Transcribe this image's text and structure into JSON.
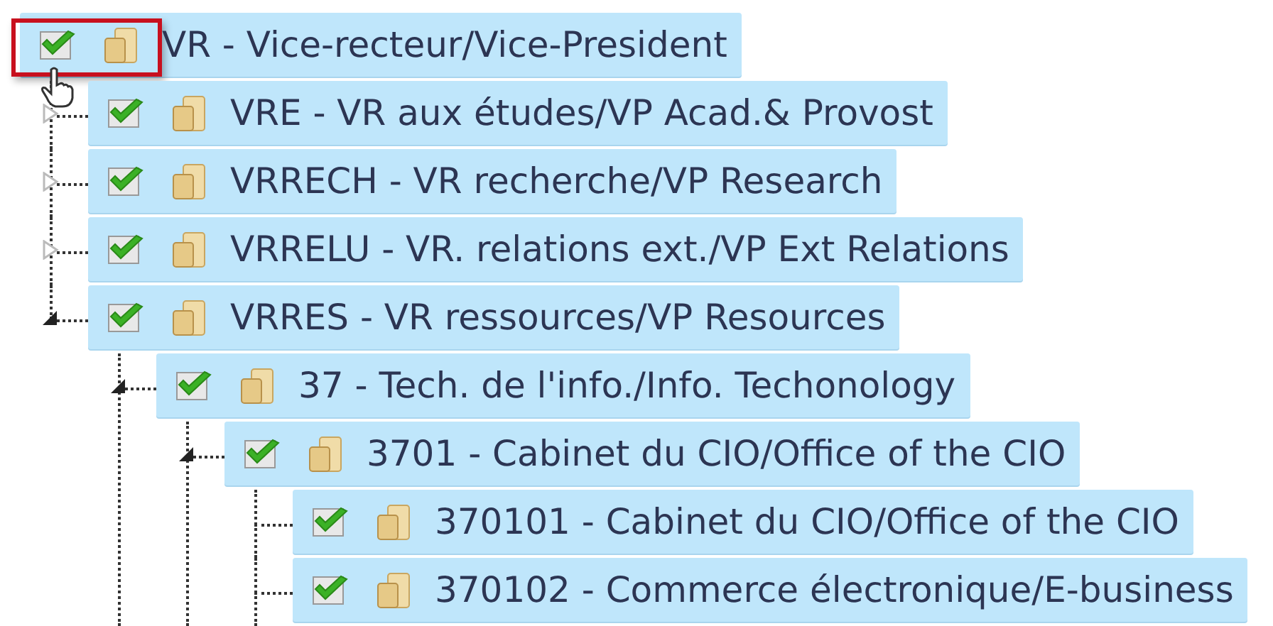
{
  "tree": [
    {
      "label": "VR - Vice-recteur/Vice-President",
      "checked": true,
      "selected": true,
      "focused": true,
      "expanded": true,
      "has_more_below": false,
      "children": [
        {
          "label": "VRE - VR aux études/VP Acad.& Provost",
          "checked": true,
          "selected": true,
          "focused": false,
          "expanded": false
        },
        {
          "label": "VRRECH - VR recherche/VP Research",
          "checked": true,
          "selected": true,
          "focused": false,
          "expanded": false
        },
        {
          "label": "VRRELU - VR. relations ext./VP Ext Relations",
          "checked": true,
          "selected": true,
          "focused": false,
          "expanded": false
        },
        {
          "label": "VRRES - VR ressources/VP Resources",
          "checked": true,
          "selected": true,
          "focused": false,
          "expanded": true,
          "has_more_below": true,
          "children": [
            {
              "label": "37 - Tech. de l'info./Info. Techonology",
              "checked": true,
              "selected": true,
              "focused": false,
              "expanded": true,
              "has_more_below": true,
              "children": [
                {
                  "label": "3701 - Cabinet du CIO/Office of the CIO",
                  "checked": true,
                  "selected": true,
                  "focused": false,
                  "expanded": true,
                  "has_more_below": true,
                  "children": [
                    {
                      "label": "370101 - Cabinet du CIO/Office of the CIO",
                      "checked": true,
                      "selected": true,
                      "focused": false
                    },
                    {
                      "label": "370102 - Commerce électronique/E-business",
                      "checked": true,
                      "selected": true,
                      "focused": false
                    }
                  ]
                }
              ]
            }
          ]
        }
      ]
    }
  ]
}
